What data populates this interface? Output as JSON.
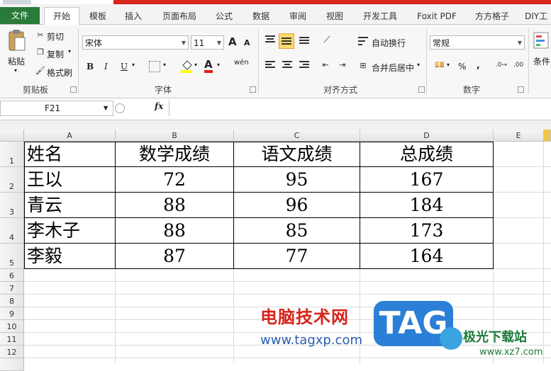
{
  "tabs": [
    "文件",
    "开始",
    "模板",
    "插入",
    "页面布局",
    "公式",
    "数据",
    "审阅",
    "视图",
    "开发工具",
    "Foxit PDF",
    "方方格子",
    "DIY工"
  ],
  "clipboard": {
    "paste": "粘贴",
    "cut": "剪切",
    "copy": "复制",
    "format_painter": "格式刷",
    "label": "剪贴板"
  },
  "font": {
    "name": "宋体",
    "size": "11",
    "label": "字体",
    "bold": "B",
    "italic": "I",
    "underline": "U",
    "grow": "A",
    "shrink": "A",
    "font_color_letter": "A",
    "phonetic": "wén"
  },
  "alignment": {
    "wrap": "自动换行",
    "merge": "合并后居中",
    "label": "对齐方式"
  },
  "number": {
    "format": "常规",
    "percent": "%",
    "comma": ",",
    "label": "数字"
  },
  "styles": {
    "conditional": "条件"
  },
  "formula_bar": {
    "name_box": "F21",
    "fx": "fx",
    "value": ""
  },
  "columns": [
    "A",
    "B",
    "C",
    "D",
    "E"
  ],
  "rows": [
    "1",
    "2",
    "3",
    "4",
    "5",
    "6",
    "7",
    "8",
    "9",
    "10",
    "11",
    "12"
  ],
  "table": {
    "headers": [
      "姓名",
      "数学成绩",
      "语文成绩",
      "总成绩"
    ],
    "rows": [
      [
        "王以",
        "72",
        "95",
        "167"
      ],
      [
        "青云",
        "88",
        "96",
        "184"
      ],
      [
        "李木子",
        "88",
        "85",
        "173"
      ],
      [
        "李毅",
        "87",
        "77",
        "164"
      ]
    ]
  },
  "watermark": {
    "title": "电脑技术网",
    "url": "www.tagxp.com",
    "tag": "TAG",
    "site": "极光下载站",
    "site_url": "www.xz7.com"
  },
  "colors": {
    "file_tab": "#2a7a3a",
    "accent_red": "#d9261c",
    "tag_blue": "#2c7fd6"
  }
}
